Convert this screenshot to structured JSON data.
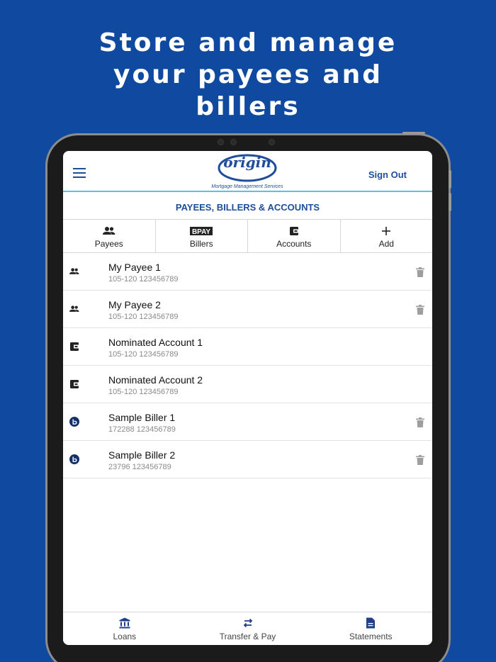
{
  "headline": [
    "Store and manage",
    "your payees and",
    "billers"
  ],
  "header": {
    "logo_text": "origin",
    "logo_subtitle": "Mortgage Management Services",
    "sign_out": "Sign Out"
  },
  "page_title": "PAYEES, BILLERS & ACCOUNTS",
  "tabs": [
    {
      "label": "Payees",
      "icon": "people-icon"
    },
    {
      "label": "Billers",
      "icon": "bpay-icon",
      "icon_text": "BPAY"
    },
    {
      "label": "Accounts",
      "icon": "wallet-icon"
    },
    {
      "label": "Add",
      "icon": "plus-icon"
    }
  ],
  "rows": [
    {
      "name": "My Payee 1",
      "detail": "105-120 123456789",
      "icon": "people-icon",
      "deletable": true
    },
    {
      "name": "My Payee 2",
      "detail": "105-120 123456789",
      "icon": "people-icon",
      "deletable": true
    },
    {
      "name": "Nominated Account 1",
      "detail": "105-120 123456789",
      "icon": "wallet-icon",
      "deletable": false
    },
    {
      "name": "Nominated Account 2",
      "detail": "105-120 123456789",
      "icon": "wallet-icon",
      "deletable": false
    },
    {
      "name": "Sample Biller 1",
      "detail": "172288 123456789",
      "icon": "bpay-circle-icon",
      "deletable": true
    },
    {
      "name": "Sample Biller 2",
      "detail": "23796 123456789",
      "icon": "bpay-circle-icon",
      "deletable": true
    }
  ],
  "bottom_nav": [
    {
      "label": "Loans",
      "icon": "bank-icon"
    },
    {
      "label": "Transfer & Pay",
      "icon": "transfer-icon"
    },
    {
      "label": "Statements",
      "icon": "document-icon"
    }
  ],
  "colors": {
    "background": "#0f4aa0",
    "brand": "#1f4d9b",
    "accent_line": "#56c4e4"
  }
}
